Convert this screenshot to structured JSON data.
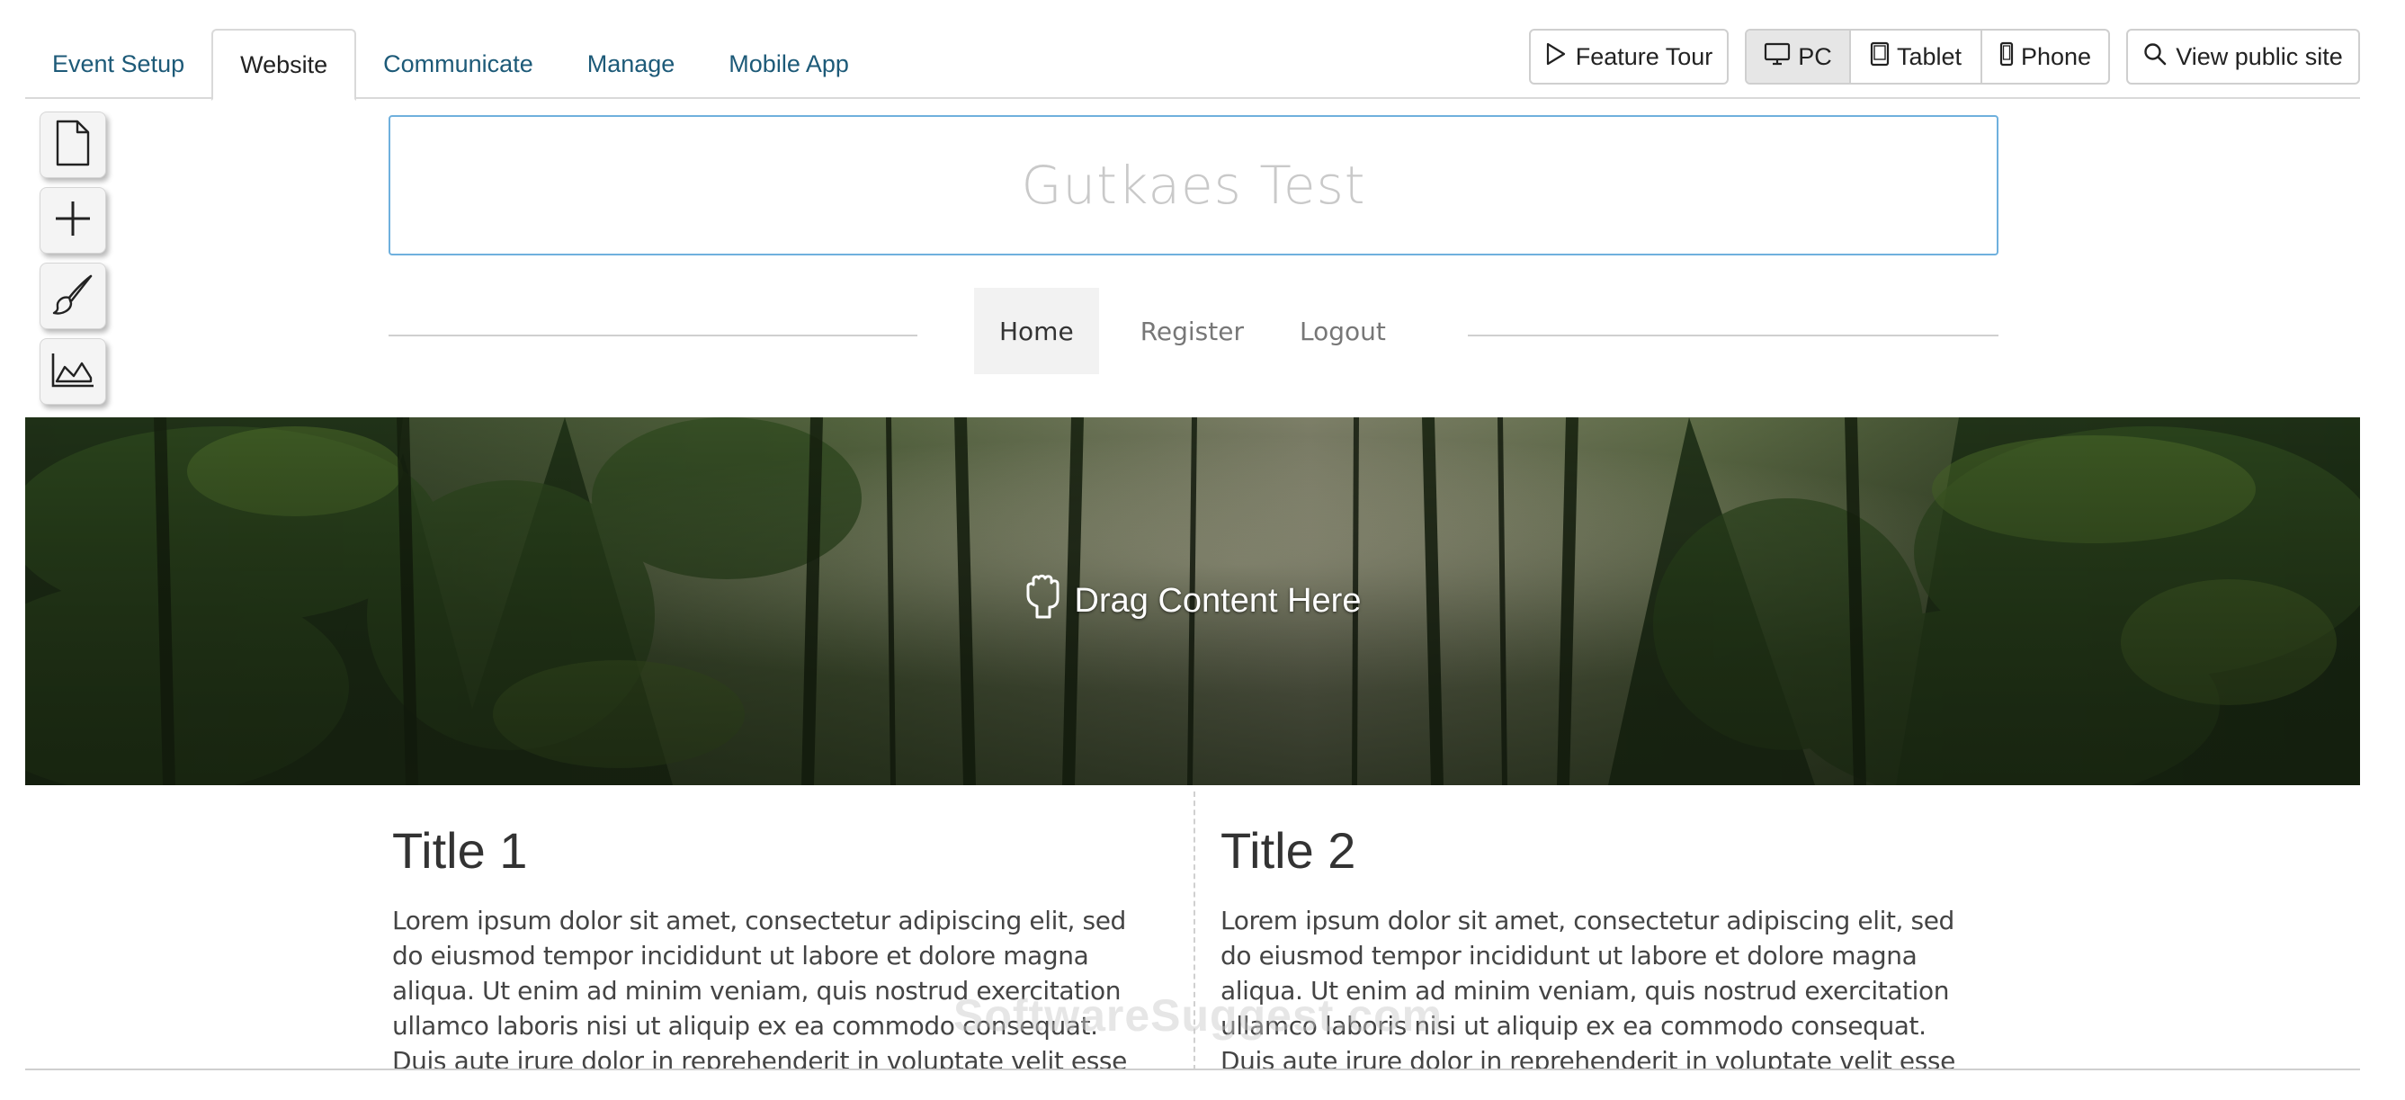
{
  "tabs": [
    {
      "label": "Event Setup",
      "active": false
    },
    {
      "label": "Website",
      "active": true
    },
    {
      "label": "Communicate",
      "active": false
    },
    {
      "label": "Manage",
      "active": false
    },
    {
      "label": "Mobile App",
      "active": false
    }
  ],
  "toolbar": {
    "feature_tour": "Feature Tour",
    "devices": [
      {
        "label": "PC",
        "icon": "monitor-icon",
        "selected": true
      },
      {
        "label": "Tablet",
        "icon": "tablet-icon",
        "selected": false
      },
      {
        "label": "Phone",
        "icon": "phone-icon",
        "selected": false
      }
    ],
    "view_public_site": "View public site"
  },
  "tools": [
    {
      "icon": "page-icon"
    },
    {
      "icon": "add-icon"
    },
    {
      "icon": "brush-icon"
    },
    {
      "icon": "area-chart-icon"
    }
  ],
  "site": {
    "title": "Gutkaes Test",
    "nav": [
      "Home",
      "Register",
      "Logout"
    ],
    "active_nav": "Home"
  },
  "hero": {
    "drop_label": "Drag Content Here"
  },
  "columns": [
    {
      "title": "Title 1",
      "body": "Lorem ipsum dolor sit amet, consectetur adipiscing elit, sed do eiusmod tempor incididunt ut labore et dolore magna aliqua. Ut enim ad minim veniam, quis nostrud exercitation ullamco laboris nisi ut aliquip ex ea commodo consequat. Duis aute irure dolor in reprehenderit in voluptate velit esse cillum dolore eu fugiat nulla"
    },
    {
      "title": "Title 2",
      "body": "Lorem ipsum dolor sit amet, consectetur adipiscing elit, sed do eiusmod tempor incididunt ut labore et dolore magna aliqua. Ut enim ad minim veniam, quis nostrud exercitation ullamco laboris nisi ut aliquip ex ea commodo consequat. Duis aute irure dolor in reprehenderit in voluptate velit esse cillum dolore eu fugiat nulla"
    }
  ],
  "watermark": "SoftwareSuggest.com",
  "colors": {
    "tab_link": "#1d5a78",
    "title_border": "#6fb0dd",
    "selected_device_bg": "#e6e6e6"
  }
}
